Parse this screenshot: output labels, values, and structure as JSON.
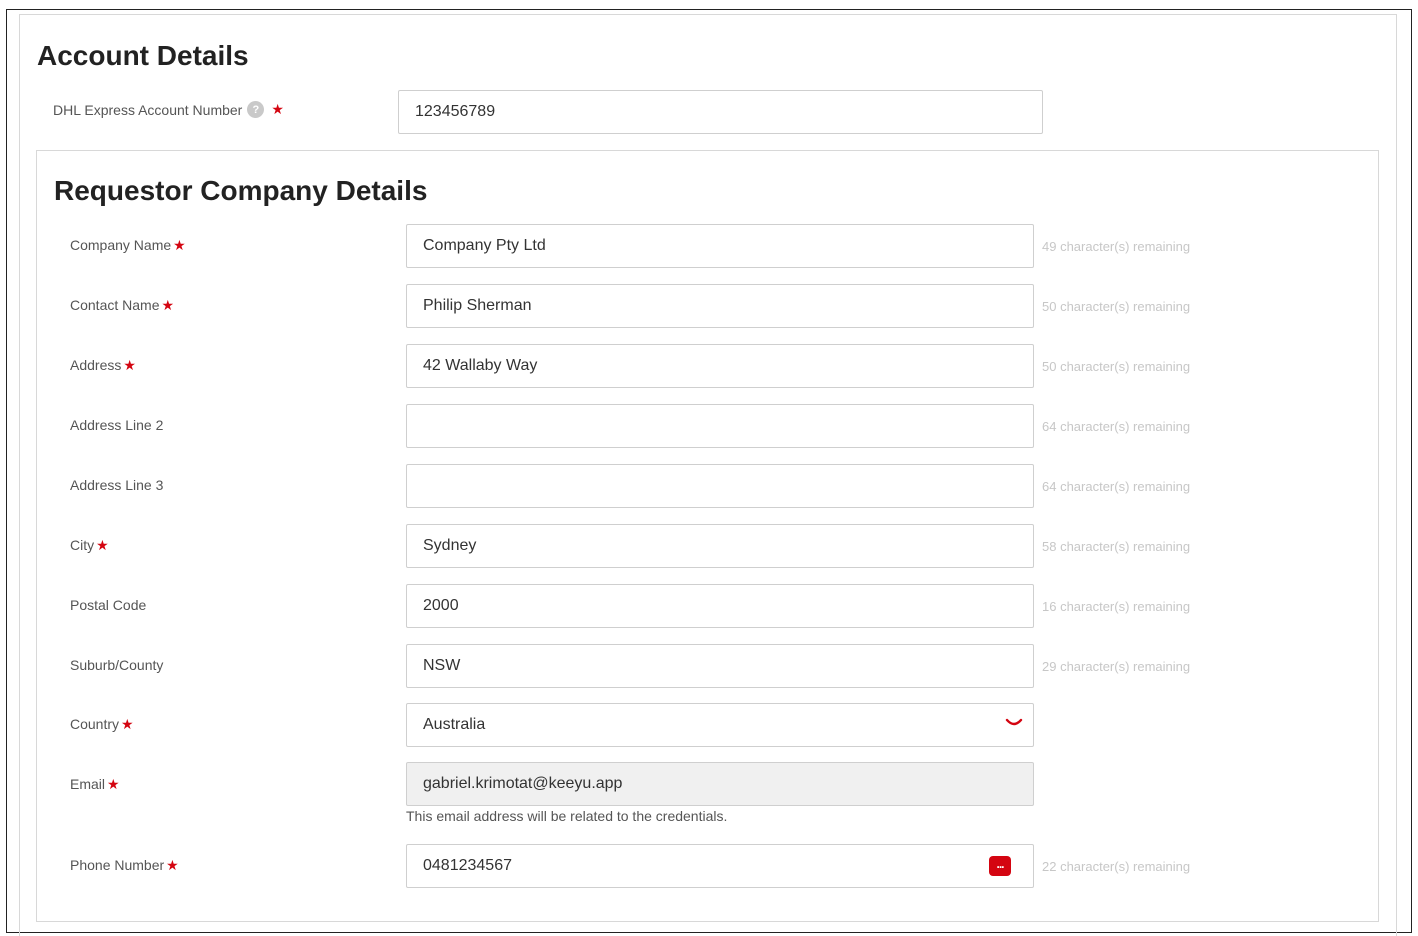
{
  "account": {
    "title": "Account Details",
    "account_number_label": "DHL Express Account Number",
    "help_glyph": "?",
    "account_number_value": "123456789"
  },
  "required_mark": "★",
  "requestor": {
    "title": "Requestor Company Details",
    "company_name": {
      "label": "Company Name",
      "value": "Company Pty Ltd",
      "remaining": "49 character(s) remaining"
    },
    "contact_name": {
      "label": "Contact Name",
      "value": "Philip Sherman",
      "remaining": "50 character(s) remaining"
    },
    "address": {
      "label": "Address",
      "value": "42 Wallaby Way",
      "remaining": "50 character(s) remaining"
    },
    "address_line_2": {
      "label": "Address Line 2",
      "value": "",
      "remaining": "64 character(s) remaining"
    },
    "address_line_3": {
      "label": "Address Line 3",
      "value": "",
      "remaining": "64 character(s) remaining"
    },
    "city": {
      "label": "City",
      "value": "Sydney",
      "remaining": "58 character(s) remaining"
    },
    "postal_code": {
      "label": "Postal Code",
      "value": "2000",
      "remaining": "16 character(s) remaining"
    },
    "suburb_county": {
      "label": "Suburb/County",
      "value": "NSW",
      "remaining": "29 character(s) remaining"
    },
    "country": {
      "label": "Country",
      "value": "Australia"
    },
    "email": {
      "label": "Email",
      "value": "gabriel.krimotat@keeyu.app",
      "hint": "This email address will be related to the credentials."
    },
    "phone_number": {
      "label": "Phone Number",
      "value": "0481234567",
      "remaining": "22 character(s) remaining",
      "icon_glyph": "..."
    }
  },
  "colors": {
    "required": "#d40511",
    "remaining_text": "#c7c7c7",
    "readonly_bg": "#f0f0f0",
    "border": "#cfcfcf"
  }
}
